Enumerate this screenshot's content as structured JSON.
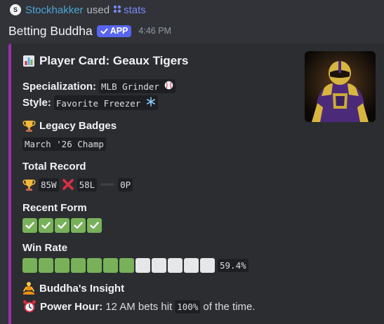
{
  "command": {
    "user": "Stockhakker",
    "used_text": "used",
    "command_name": "stats",
    "avatar_initial": "S"
  },
  "message": {
    "author": "Betting Buddha",
    "app_badge": "APP",
    "timestamp": "4:46 PM"
  },
  "embed": {
    "accent_color": "#9b2fae",
    "title": "Player Card: Geaux Tigers",
    "title_icon": "bar-chart-icon",
    "specialization": {
      "label": "Specialization:",
      "value": "MLB Grinder",
      "icon": "baseball-icon"
    },
    "style": {
      "label": "Style:",
      "value": "Favorite Freezer",
      "icon": "snowflake-icon"
    },
    "legacy_badges": {
      "title": "Legacy Badges",
      "icon": "trophy-icon",
      "value": "March '26 Champ"
    },
    "total_record": {
      "title": "Total Record",
      "wins": "85W",
      "losses": "58L",
      "pushes": "0P",
      "icons": [
        "trophy-icon",
        "cross-mark-icon",
        "dash-icon"
      ]
    },
    "recent_form": {
      "title": "Recent Form",
      "results": [
        "win",
        "win",
        "win",
        "win",
        "win"
      ]
    },
    "win_rate": {
      "title": "Win Rate",
      "value_text": "59.4%",
      "fraction": 0.594,
      "segments": 12,
      "filled_segments": 7
    },
    "insight": {
      "title": "Buddha's Insight",
      "title_icon": "meditating-person-icon",
      "label": "Power Hour:",
      "icon": "alarm-clock-icon",
      "text_before": "12 AM bets hit",
      "highlight": "100%",
      "text_after": "of the time."
    },
    "thumbnail": "football-player-purple-gold-uniform"
  },
  "colors": {
    "background": "#313338",
    "embed_bg": "#2b2d31",
    "brand": "#5865f2",
    "win_green": "#78b159",
    "loss_red": "#dd2e44"
  }
}
